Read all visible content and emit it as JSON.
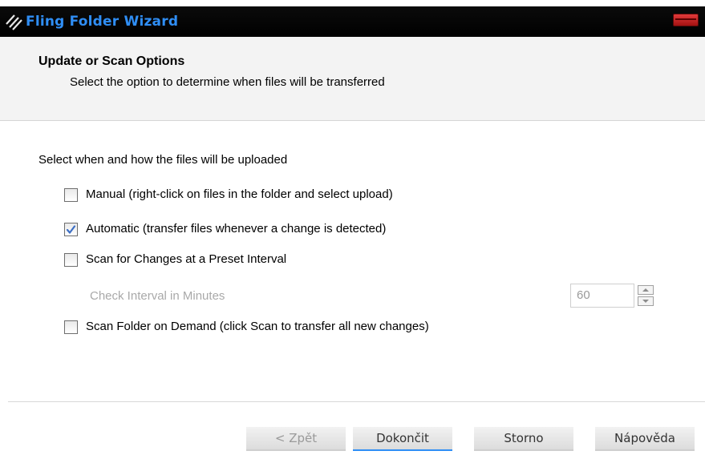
{
  "window": {
    "title": "Fling Folder Wizard"
  },
  "header": {
    "title": "Update or Scan Options",
    "subtitle": "Select the option to determine when files will be transferred"
  },
  "body": {
    "section_label": "Select when and how the files will be uploaded",
    "options": [
      {
        "label": "Manual (right-click on files in the folder and select upload)",
        "checked": false
      },
      {
        "label": "Automatic (transfer files whenever a change is detected)",
        "checked": true
      },
      {
        "label": "Scan for Changes at a Preset Interval",
        "checked": false
      },
      {
        "label": "Scan Folder on Demand (click Scan to transfer all new changes)",
        "checked": false
      }
    ],
    "interval": {
      "label": "Check Interval in Minutes",
      "value": "60",
      "enabled": false
    }
  },
  "buttons": {
    "back": "< Zpět",
    "finish": "Dokončit",
    "cancel": "Storno",
    "help": "Nápověda"
  },
  "colors": {
    "title_accent": "#2f8ef5",
    "check": "#3d6fc4"
  }
}
